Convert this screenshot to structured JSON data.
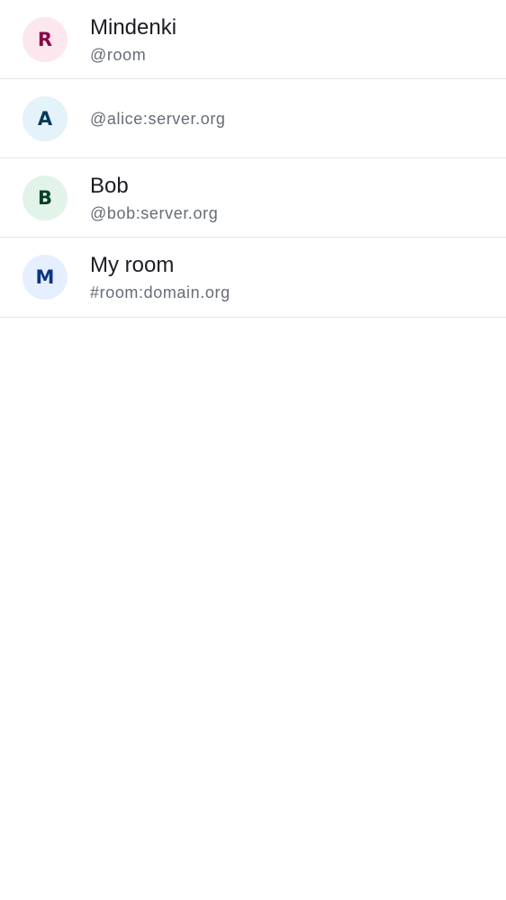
{
  "suggestions": [
    {
      "initial": "R",
      "name": "Mindenki",
      "id": "@room",
      "avatar_bg": "#fde7ee",
      "avatar_fg": "#8a0847"
    },
    {
      "initial": "A",
      "name": "",
      "id": "@alice:server.org",
      "avatar_bg": "#e3f3f9",
      "avatar_fg": "#053a5b"
    },
    {
      "initial": "B",
      "name": "Bob",
      "id": "@bob:server.org",
      "avatar_bg": "#e2f4ea",
      "avatar_fg": "#064227"
    },
    {
      "initial": "M",
      "name": "My room",
      "id": "#room:domain.org",
      "avatar_bg": "#e6efff",
      "avatar_fg": "#093880"
    }
  ]
}
